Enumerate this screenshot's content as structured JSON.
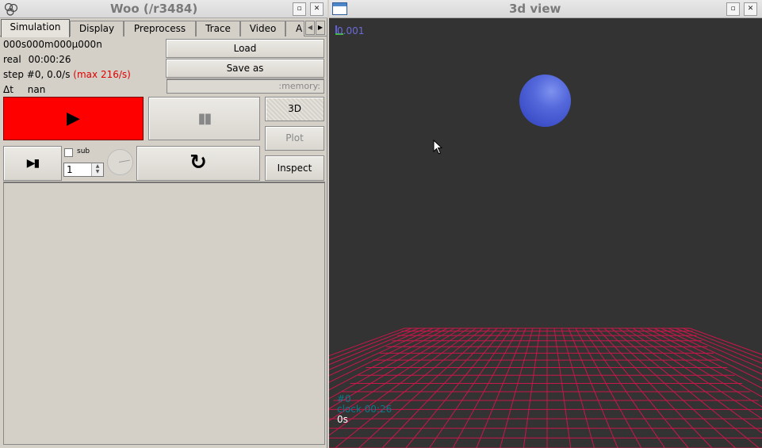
{
  "left_window": {
    "title": "Woo (/r3484)",
    "tabs": [
      "Simulation",
      "Display",
      "Preprocess",
      "Trace",
      "Video",
      "A"
    ],
    "active_tab": "Simulation",
    "info": {
      "time": "000s000m000µ000n",
      "real_label": "real",
      "real_value": "00:00:26",
      "step_text": "step #0, 0.0/s",
      "step_max": "(max 216/s)",
      "dt_label": "Δt",
      "dt_value": "nan"
    },
    "buttons": {
      "load": "Load",
      "save_as": "Save as",
      "memory": ":memory:",
      "view_3d": "3D",
      "plot": "Plot",
      "inspect": "Inspect",
      "play_symbol": "▶",
      "pause_symbol": "▮▮",
      "step_symbol": "▶▮",
      "reload_symbol": "↻"
    },
    "sub_label": "sub",
    "sub_checked": false,
    "sub_steps": "1"
  },
  "right_window": {
    "title": "3d view",
    "scale_label": "0.001",
    "overlay": {
      "step": "#0",
      "clock": "clock 00:26",
      "time": "0s"
    },
    "colors": {
      "background": "#333333",
      "grid": "#c8174a",
      "sphere": "#4a5ed8",
      "overlay_cyan": "#0a7a8a"
    }
  },
  "icons": {
    "app_logo": "woo-logo-icon",
    "window_icon": "window-icon",
    "maximize": "maximize-icon",
    "close": "close-icon"
  }
}
